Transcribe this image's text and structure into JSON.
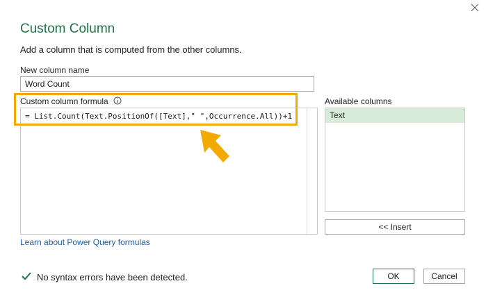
{
  "dialog": {
    "title": "Custom Column",
    "subtitle": "Add a column that is computed from the other columns."
  },
  "new_column": {
    "label": "New column name",
    "value": "Word Count"
  },
  "formula": {
    "label": "Custom column formula",
    "value": "= List.Count(Text.PositionOf([Text],\" \",Occurrence.All))+1"
  },
  "available_columns": {
    "label": "Available columns",
    "items": [
      "Text"
    ]
  },
  "buttons": {
    "insert": "<< Insert",
    "ok": "OK",
    "cancel": "Cancel"
  },
  "learn_link": "Learn about Power Query formulas",
  "status": {
    "text": "No syntax errors have been detected.",
    "icon": "checkmark-icon"
  },
  "colors": {
    "title": "#217346",
    "highlight": "#f2a900",
    "selected_item": "#d6ecd9",
    "link": "#1f5a9e",
    "check": "#217346"
  }
}
